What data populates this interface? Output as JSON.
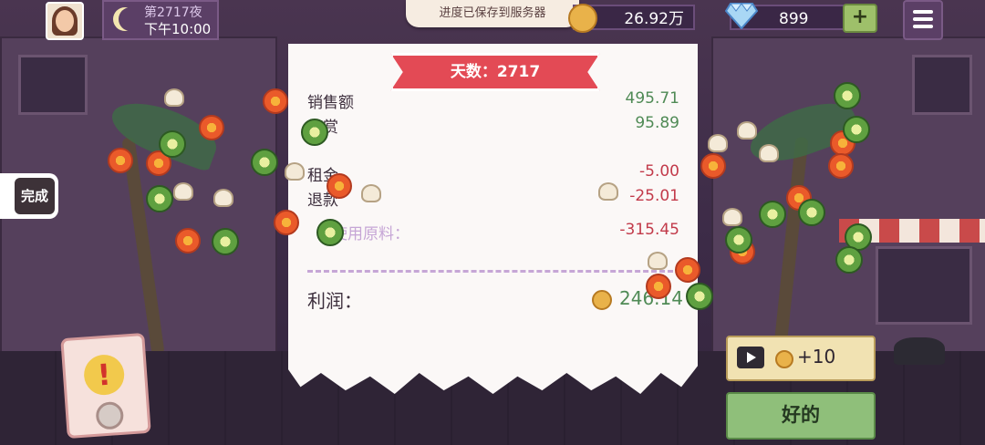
{
  "hud": {
    "day_label": "第2717夜",
    "time_label": "下午10:00",
    "coins": "26.92万",
    "gems": "899",
    "plus_label": "+"
  },
  "toast": "进度已保存到服务器",
  "side": {
    "done_label": "完成",
    "alert_symbol": "!"
  },
  "receipt": {
    "ribbon": "天数：2717",
    "rows": [
      {
        "label": "销售额",
        "value": "495.71"
      },
      {
        "label": "打赏",
        "value": "95.89"
      },
      {
        "label": "租金",
        "value": "-5.00"
      },
      {
        "label": "退款",
        "value": "-25.01"
      },
      {
        "label": "使用原料：",
        "value": "-315.45"
      }
    ],
    "profit_label": "利润：",
    "profit_value": "246.14"
  },
  "buttons": {
    "ad_reward": "+10",
    "ok": "好的"
  },
  "colors": {
    "positive": "#4f8a55",
    "negative": "#c23a4a",
    "ribbon": "#e34a55",
    "ok": "#8fbf7a"
  },
  "icons": [
    "moon-icon",
    "coin-icon",
    "gem-icon",
    "menu-icon",
    "play-icon",
    "alert-icon"
  ]
}
